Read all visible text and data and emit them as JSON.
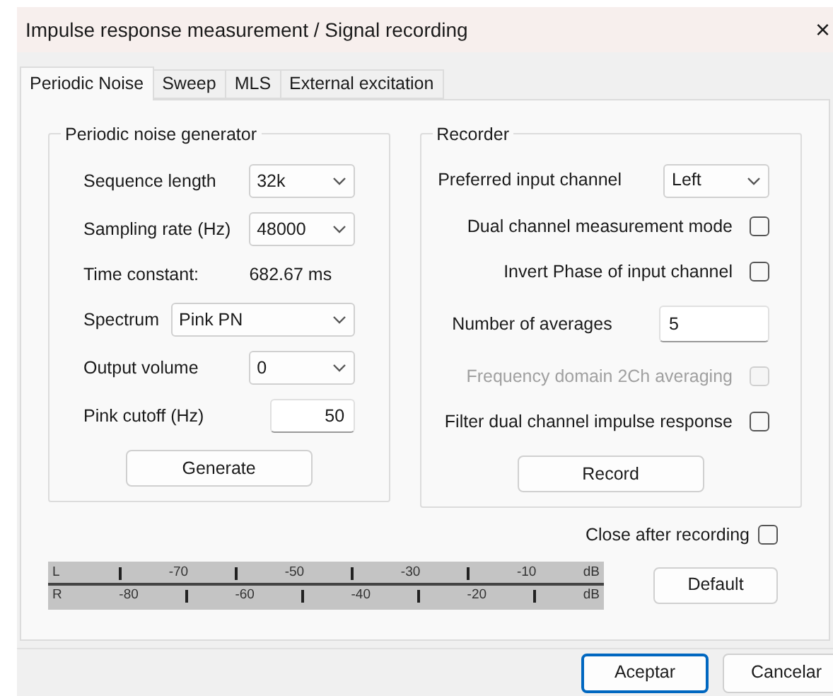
{
  "window": {
    "title": "Impulse response measurement / Signal recording",
    "close": "×"
  },
  "tabs": [
    {
      "label": "Periodic Noise",
      "selected": true
    },
    {
      "label": "Sweep",
      "selected": false
    },
    {
      "label": "MLS",
      "selected": false
    },
    {
      "label": "External excitation",
      "selected": false
    }
  ],
  "generator": {
    "title": "Periodic noise generator",
    "rows": [
      {
        "kind": "select",
        "label": "Sequence length",
        "value": "32k"
      },
      {
        "kind": "select",
        "label": "Sampling rate (Hz)",
        "value": "48000"
      },
      {
        "kind": "value",
        "label": "Time constant:",
        "value": "682.67 ms"
      },
      {
        "kind": "wide_select",
        "label": "Spectrum",
        "value": "Pink PN"
      },
      {
        "kind": "select",
        "label": "Output volume",
        "value": "0"
      },
      {
        "kind": "input",
        "label": "Pink cutoff (Hz)",
        "value": "50"
      }
    ],
    "button": "Generate"
  },
  "recorder": {
    "title": "Recorder",
    "rows": [
      {
        "kind": "select",
        "label": "Preferred input channel",
        "value": "Left"
      },
      {
        "kind": "checkbox",
        "label": "Dual channel measurement mode",
        "checked": false,
        "disabled": false
      },
      {
        "kind": "checkbox",
        "label": "Invert Phase of input channel",
        "checked": false,
        "disabled": false
      },
      {
        "kind": "input",
        "label": "Number of averages",
        "value": "5"
      },
      {
        "kind": "checkbox",
        "label": "Frequency domain 2Ch averaging",
        "checked": false,
        "disabled": true
      },
      {
        "kind": "checkbox",
        "label": "Filter dual channel impulse response",
        "checked": false,
        "disabled": false
      }
    ],
    "button": "Record"
  },
  "close_after_recording": {
    "label": "Close after recording",
    "checked": false
  },
  "meter": [
    {
      "channel": "L",
      "kind": "tick_first",
      "scale": [
        "-70",
        "-50",
        "-30",
        "-10"
      ],
      "unit": "dB"
    },
    {
      "channel": "R",
      "kind": "label_first",
      "scale": [
        "-80",
        "-60",
        "-40",
        "-20"
      ],
      "unit": "dB"
    }
  ],
  "default_button": "Default",
  "buttons": [
    {
      "label": "Aceptar",
      "selected": true
    },
    {
      "label": "Cancelar",
      "selected": false
    }
  ]
}
